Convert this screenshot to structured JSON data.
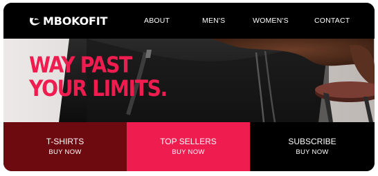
{
  "brand": {
    "name": "MBOKOFIT",
    "logo_icon": "swoosh-mark-icon"
  },
  "nav": {
    "about": "ABOUT",
    "mens": "MEN'S",
    "womens": "WOMEN'S",
    "contact": "CONTACT"
  },
  "hero": {
    "line1": "WAY PAST",
    "line2": "YOUR LIMITS.",
    "accent_color": "#ee1c4f"
  },
  "tiles": [
    {
      "title": "T-SHIRTS",
      "action": "BUY NOW",
      "color": "#6d0a10"
    },
    {
      "title": "TOP SELLERS",
      "action": "BUY NOW",
      "color": "#ee1c4f"
    },
    {
      "title": "SUBSCRIBE",
      "action": "BUY NOW",
      "color": "#000000"
    }
  ]
}
